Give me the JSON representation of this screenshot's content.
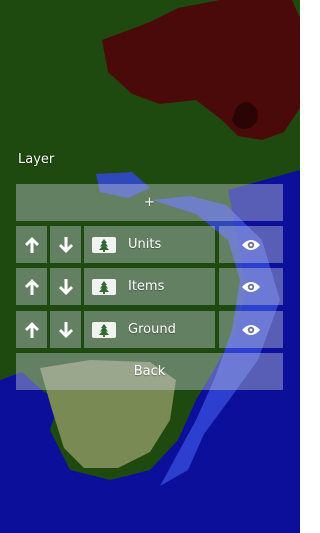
{
  "panel": {
    "title": "Layer",
    "add_label": "+",
    "back_label": "Back"
  },
  "layers": [
    {
      "name": "Units",
      "visible": true,
      "icon": "tree-icon"
    },
    {
      "name": "Items",
      "visible": true,
      "icon": "tree-icon"
    },
    {
      "name": "Ground",
      "visible": true,
      "icon": "tree-icon"
    }
  ],
  "icons": {
    "move_up": "arrow-up-icon",
    "move_down": "arrow-down-icon",
    "visibility": "eye-icon"
  },
  "colors": {
    "grass": "#1f4a0f",
    "water": "#0b0f9a",
    "shallow_water": "#3248d8",
    "mountain": "#4a0a0a",
    "sand": "#7a8a55",
    "tree": "#2e6b33",
    "button_overlay": "#cdd2de"
  }
}
